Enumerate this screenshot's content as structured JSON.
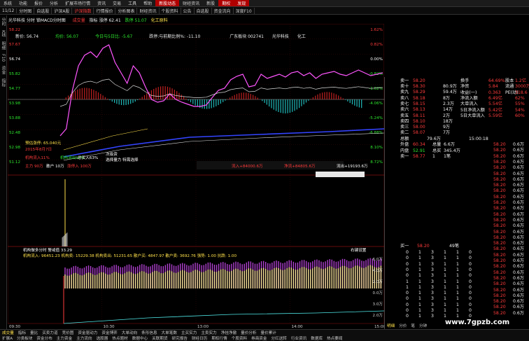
{
  "menu": [
    "系统",
    "功能",
    "报价",
    "分析",
    "扩展市场行情",
    "资讯",
    "交易",
    "工具",
    "帮助",
    "新股动态",
    "财经资讯",
    "新股",
    "期权",
    "发现"
  ],
  "toolbar": [
    "11/12",
    "分时图",
    "自选股",
    "沪深A股",
    "沪深指数",
    "行情报价",
    "分析图表",
    "财经资讯",
    "个股资料",
    "公告",
    "自选股",
    "资金流向",
    "深度F10"
  ],
  "header": {
    "title": "光华科技 分时 锁MACD分时图",
    "kuan_label": "成交量",
    "metric1": "指标 涨停 62.41",
    "metric2": "跌停 51.07",
    "sector": "化工原料"
  },
  "info_line": {
    "price": "新价: 56.74",
    "junjia": "均价: 56.07",
    "ratio": "今日与5日比: -5.67",
    "zdf": "跌停:与前期比例%: -11.10",
    "plate": "广东板块 002741",
    "name": "光华科技",
    "industry": "化工"
  },
  "chart_labels": {
    "left_ticks": [
      "58.22",
      "57.67",
      "56.74",
      "55.82",
      "54.77",
      "53.98",
      "53.88",
      "52.48",
      "52.98",
      "51.12"
    ],
    "right_ticks": [
      "1.62%",
      "0.82%",
      "0.00%",
      "-0.82%",
      "-1.62%",
      "-4.06%",
      "-5.24%",
      "-6.88%",
      "8.10%",
      "8.72%"
    ],
    "annotations": [
      "预估涨停: 65.040元",
      "2015年8月7日",
      "机构流入11%",
      "机构流出12%",
      "总买入63%",
      "主力 90万",
      "散户 10万",
      "涨停入 100万",
      "次级资",
      "选择量力 特需选择"
    ],
    "flow_labels": [
      "流入+84000.6万",
      "净流+84805.6万",
      "流出+19193.6万"
    ],
    "volume_header": "机构做多分时 警戒值 33.29",
    "volume_stats": "机构流入: 96451.23  机构卖: 15229.38  机构卖出: 51231.65  散户买: 4847.97  散户卖: 3692.76  强势: 1.00  抗跌: 1.00",
    "vol_ticks_right": [
      "6.0万",
      "4.0万",
      "2.0万",
      "0.0万",
      "3.0万",
      "2.0万"
    ],
    "time_ticks": [
      "09:30",
      "10:30",
      "13:00",
      "14:00",
      "15:00"
    ],
    "volume_right_label": "右键设置"
  },
  "quote": {
    "sell": [
      {
        "label": "卖十",
        "price": "58.30",
        "vol": "80.9万"
      },
      {
        "label": "卖九",
        "price": "58.29",
        "vol": "59.4万"
      },
      {
        "label": "卖八",
        "price": "58.18",
        "vol": "8万"
      },
      {
        "label": "卖七",
        "price": "58.15",
        "vol": "2.3万"
      },
      {
        "label": "卖六",
        "price": "58.13",
        "vol": "14万"
      },
      {
        "label": "卖五",
        "price": "58.11",
        "vol": "2万"
      },
      {
        "label": "卖四",
        "price": "58.10",
        "vol": "18万"
      },
      {
        "label": "卖三",
        "price": "58.00",
        "vol": "9万"
      },
      {
        "label": "卖二",
        "price": "58.07",
        "vol": "7万"
      }
    ],
    "top_price": "58.20",
    "current": "最新",
    "stats": [
      {
        "k": "换手",
        "v": "64.69%",
        "k2": "股本",
        "v2": "1.2亿"
      },
      {
        "k": "净资",
        "v": "5.84",
        "k2": "流通",
        "v2": "3000万"
      },
      {
        "k": "收益(一)",
        "v": "0.363",
        "k2": "PE(动)",
        "v2": "318.6"
      },
      {
        "k": "净流入额",
        "v": "6.49亿",
        "k2": "",
        "v2": "62%"
      },
      {
        "k": "大单流入",
        "v": "5.54亿",
        "k2": "",
        "v2": "55%"
      },
      {
        "k": "5日净流入额",
        "v": "5.42亿",
        "k2": "",
        "v2": "54%"
      },
      {
        "k": "5日大单流入",
        "v": "5.59亿",
        "k2": "",
        "v2": "60%"
      }
    ],
    "mid_rows": [
      {
        "label": "总额",
        "price": "79.6万",
        "time": "15:00:18"
      },
      {
        "label": "外盘",
        "price": "60.34",
        "vol": "总量",
        "v2": "6.6万"
      },
      {
        "label": "内盘",
        "price": "52.91",
        "vol": "总买",
        "v2": "345.4万"
      },
      {
        "label": "卖一",
        "price": "58.77",
        "vol": "1",
        "v2": "1笔"
      }
    ],
    "ticks": [
      {
        "p": "58.20",
        "v": "0.6万"
      },
      {
        "p": "58.20",
        "v": "0.6万"
      },
      {
        "p": "58.20",
        "v": "0.6万"
      },
      {
        "p": "58.20",
        "v": "0.6万"
      },
      {
        "p": "58.20",
        "v": "0.6万"
      },
      {
        "p": "58.20",
        "v": "0.6万"
      },
      {
        "p": "58.20",
        "v": "0.6万"
      },
      {
        "p": "58.20",
        "v": "0.6万"
      },
      {
        "p": "58.20",
        "v": "0.6万"
      },
      {
        "p": "58.20",
        "v": "0.6万"
      },
      {
        "p": "58.20",
        "v": "0.6万"
      },
      {
        "p": "58.20",
        "v": "0.6万"
      },
      {
        "p": "58.20",
        "v": "0.6万"
      },
      {
        "p": "58.20",
        "v": "0.6万"
      },
      {
        "p": "58.20",
        "v": "0.6万"
      },
      {
        "p": "58.20",
        "v": "0.6万"
      },
      {
        "p": "58.20",
        "v": "0.6万"
      },
      {
        "p": "58.20",
        "v": "0.6万"
      },
      {
        "p": "58.20",
        "v": "0.6万"
      },
      {
        "p": "58.20",
        "v": "0.6万"
      },
      {
        "p": "58.20",
        "v": "0.6万"
      },
      {
        "p": "58.20",
        "v": "0.6万"
      },
      {
        "p": "58.20",
        "v": "0.6万"
      },
      {
        "p": "58.20",
        "v": "0.6万"
      },
      {
        "p": "58.20",
        "v": "0.6万"
      },
      {
        "p": "58.20",
        "v": "0.6万"
      },
      {
        "p": "58.20",
        "v": "0.6万"
      },
      {
        "p": "58.20",
        "v": "0.6万"
      },
      {
        "p": "58.20",
        "v": "0.6万"
      },
      {
        "p": "58.20",
        "v": "0.6万"
      },
      {
        "p": "58.20",
        "v": "0.6万"
      },
      {
        "p": "58.20",
        "v": "0.6万"
      }
    ],
    "buy_head": {
      "label": "买一",
      "price": "58.20",
      "vol": "49笔"
    },
    "buy_rows": [
      [
        "0",
        "1",
        "3",
        "1",
        "1",
        "0"
      ],
      [
        "0",
        "1",
        "3",
        "1",
        "1",
        "0"
      ],
      [
        "0",
        "1",
        "3",
        "1",
        "1",
        "0"
      ],
      [
        "0",
        "1",
        "3",
        "1",
        "1",
        "0"
      ],
      [
        "0",
        "1",
        "3",
        "1",
        "1",
        "0"
      ],
      [
        "1",
        "1",
        "3",
        "1",
        "1",
        "0"
      ],
      [
        "1",
        "1",
        "3",
        "1",
        "1",
        "0"
      ],
      [
        "0",
        "1",
        "3",
        "1",
        "1",
        "0"
      ],
      [
        "0",
        "1",
        "3",
        "1",
        "1",
        "0"
      ],
      [
        "0",
        "1",
        "3",
        "1",
        "1",
        "0"
      ],
      [
        "0",
        "1",
        "3",
        "1",
        "1",
        "0"
      ],
      [
        "0",
        "1",
        "3",
        "1",
        "1",
        "0"
      ]
    ]
  },
  "bottom_tabs1": [
    "成交量",
    "指标",
    "量比",
    "买卖力道",
    "竞价图",
    "资金驱动力",
    "资金博弈",
    "大单动向",
    "条形信息",
    "大单笔数",
    "主买实力",
    "主卖实力",
    "净挂净撤",
    "量价分析",
    "量价累计"
  ],
  "bottom_tabs2": [
    "扩展A",
    "分类板块",
    "资金分布",
    "主力资金",
    "主力流向",
    "选股器",
    "热点题材",
    "数据中心",
    "关联期货",
    "研究报告",
    "财经日历",
    "期权行情",
    "个股资料",
    "券商资金",
    "分红送转",
    "行业资讯",
    "数据库",
    "热点要闻"
  ],
  "right_tabs": [
    "明细",
    "分价",
    "笔",
    "分钟"
  ],
  "watermark": "www.7gpzb.com",
  "colors": {
    "price_line": "#ff55ff",
    "avg_line": "#ffe14a",
    "up": "#ff3b3b",
    "down": "#2ee82e",
    "ma_blue": "#3344ff"
  }
}
